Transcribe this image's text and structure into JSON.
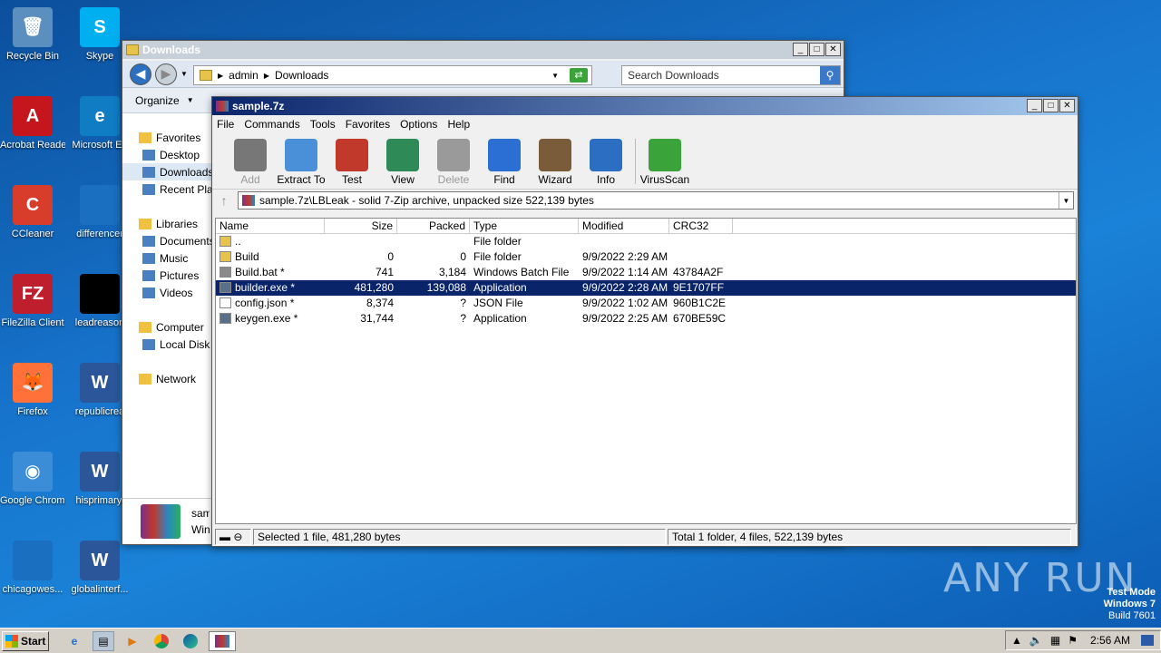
{
  "desktop": {
    "icons": [
      {
        "label": "Recycle Bin",
        "color": "#5a8fbf"
      },
      {
        "label": "Acrobat Reader DC",
        "color": "#c4161c"
      },
      {
        "label": "CCleaner",
        "color": "#d83c2b"
      },
      {
        "label": "FileZilla Client",
        "color": "#bf1e2d"
      },
      {
        "label": "Firefox",
        "color": "#ff7139"
      },
      {
        "label": "Google Chrome",
        "color": "#3b8dd8"
      },
      {
        "label": "chicagowes...",
        "color": "#1a6fc0"
      },
      {
        "label": "Skype",
        "color": "#00aff0"
      },
      {
        "label": "Microsoft Ed",
        "color": "#0f7cc4"
      },
      {
        "label": "differencer",
        "color": "#1a6fc0"
      },
      {
        "label": "leadreason",
        "color": "#000000"
      },
      {
        "label": "republicrea",
        "color": "#2b579a"
      },
      {
        "label": "hisprimary.",
        "color": "#2b579a"
      },
      {
        "label": "globalinterf...",
        "color": "#2b579a"
      }
    ]
  },
  "explorer": {
    "title": "Downloads",
    "address": [
      "admin",
      "Downloads"
    ],
    "search_placeholder": "Search Downloads",
    "organize": "Organize",
    "nav": [
      {
        "label": "Favorites",
        "head": true
      },
      {
        "label": "Desktop"
      },
      {
        "label": "Downloads",
        "selected": true
      },
      {
        "label": "Recent Places"
      },
      {
        "label": "",
        "spacer": true
      },
      {
        "label": "Libraries",
        "head": true
      },
      {
        "label": "Documents"
      },
      {
        "label": "Music"
      },
      {
        "label": "Pictures"
      },
      {
        "label": "Videos"
      },
      {
        "label": "",
        "spacer": true
      },
      {
        "label": "Computer",
        "head": true
      },
      {
        "label": "Local Disk"
      },
      {
        "label": "",
        "spacer": true
      },
      {
        "label": "Network",
        "head": true
      }
    ],
    "details_name": "sample",
    "details_type": "WinRAR"
  },
  "zip": {
    "title": "sample.7z",
    "menu": [
      "File",
      "Commands",
      "Tools",
      "Favorites",
      "Options",
      "Help"
    ],
    "tools": [
      {
        "label": "Add",
        "disabled": true,
        "icon": "add-icon",
        "color": "#777777"
      },
      {
        "label": "Extract To",
        "icon": "extract-icon",
        "color": "#4a90d9"
      },
      {
        "label": "Test",
        "icon": "test-icon",
        "color": "#c0392b"
      },
      {
        "label": "View",
        "icon": "view-icon",
        "color": "#2e8b57"
      },
      {
        "label": "Delete",
        "disabled": true,
        "icon": "delete-icon",
        "color": "#9a9a9a"
      },
      {
        "label": "Find",
        "icon": "find-icon",
        "color": "#2a6fd1"
      },
      {
        "label": "Wizard",
        "icon": "wizard-icon",
        "color": "#7a5c3a"
      },
      {
        "label": "Info",
        "icon": "info-icon",
        "color": "#2c6fc2"
      },
      {
        "label": "VirusScan",
        "icon": "virusscan-icon",
        "color": "#3aa33a"
      }
    ],
    "path": "sample.7z\\LBLeak - solid 7-Zip archive, unpacked size 522,139 bytes",
    "columns": [
      "Name",
      "Size",
      "Packed",
      "Type",
      "Modified",
      "CRC32"
    ],
    "rows": [
      {
        "name": "..",
        "size": "",
        "packed": "",
        "type": "File folder",
        "modified": "",
        "crc": "",
        "kind": "folder"
      },
      {
        "name": "Build",
        "size": "0",
        "packed": "0",
        "type": "File folder",
        "modified": "9/9/2022 2:29 AM",
        "crc": "",
        "kind": "folder"
      },
      {
        "name": "Build.bat *",
        "size": "741",
        "packed": "3,184",
        "type": "Windows Batch File",
        "modified": "9/9/2022 1:14 AM",
        "crc": "43784A2F",
        "kind": "bat"
      },
      {
        "name": "builder.exe *",
        "size": "481,280",
        "packed": "139,088",
        "type": "Application",
        "modified": "9/9/2022 2:28 AM",
        "crc": "9E1707FF",
        "kind": "exe",
        "selected": true
      },
      {
        "name": "config.json *",
        "size": "8,374",
        "packed": "?",
        "type": "JSON File",
        "modified": "9/9/2022 1:02 AM",
        "crc": "960B1C2E",
        "kind": "file"
      },
      {
        "name": "keygen.exe *",
        "size": "31,744",
        "packed": "?",
        "type": "Application",
        "modified": "9/9/2022 2:25 AM",
        "crc": "670BE59C",
        "kind": "exe"
      }
    ],
    "status_left": "Selected 1 file, 481,280 bytes",
    "status_right": "Total 1 folder, 4 files, 522,139 bytes"
  },
  "taskbar": {
    "start": "Start",
    "clock": "2:56 AM"
  },
  "watermark": [
    "Test Mode",
    "Windows 7",
    "Build 7601"
  ],
  "brand": "ANY RUN"
}
